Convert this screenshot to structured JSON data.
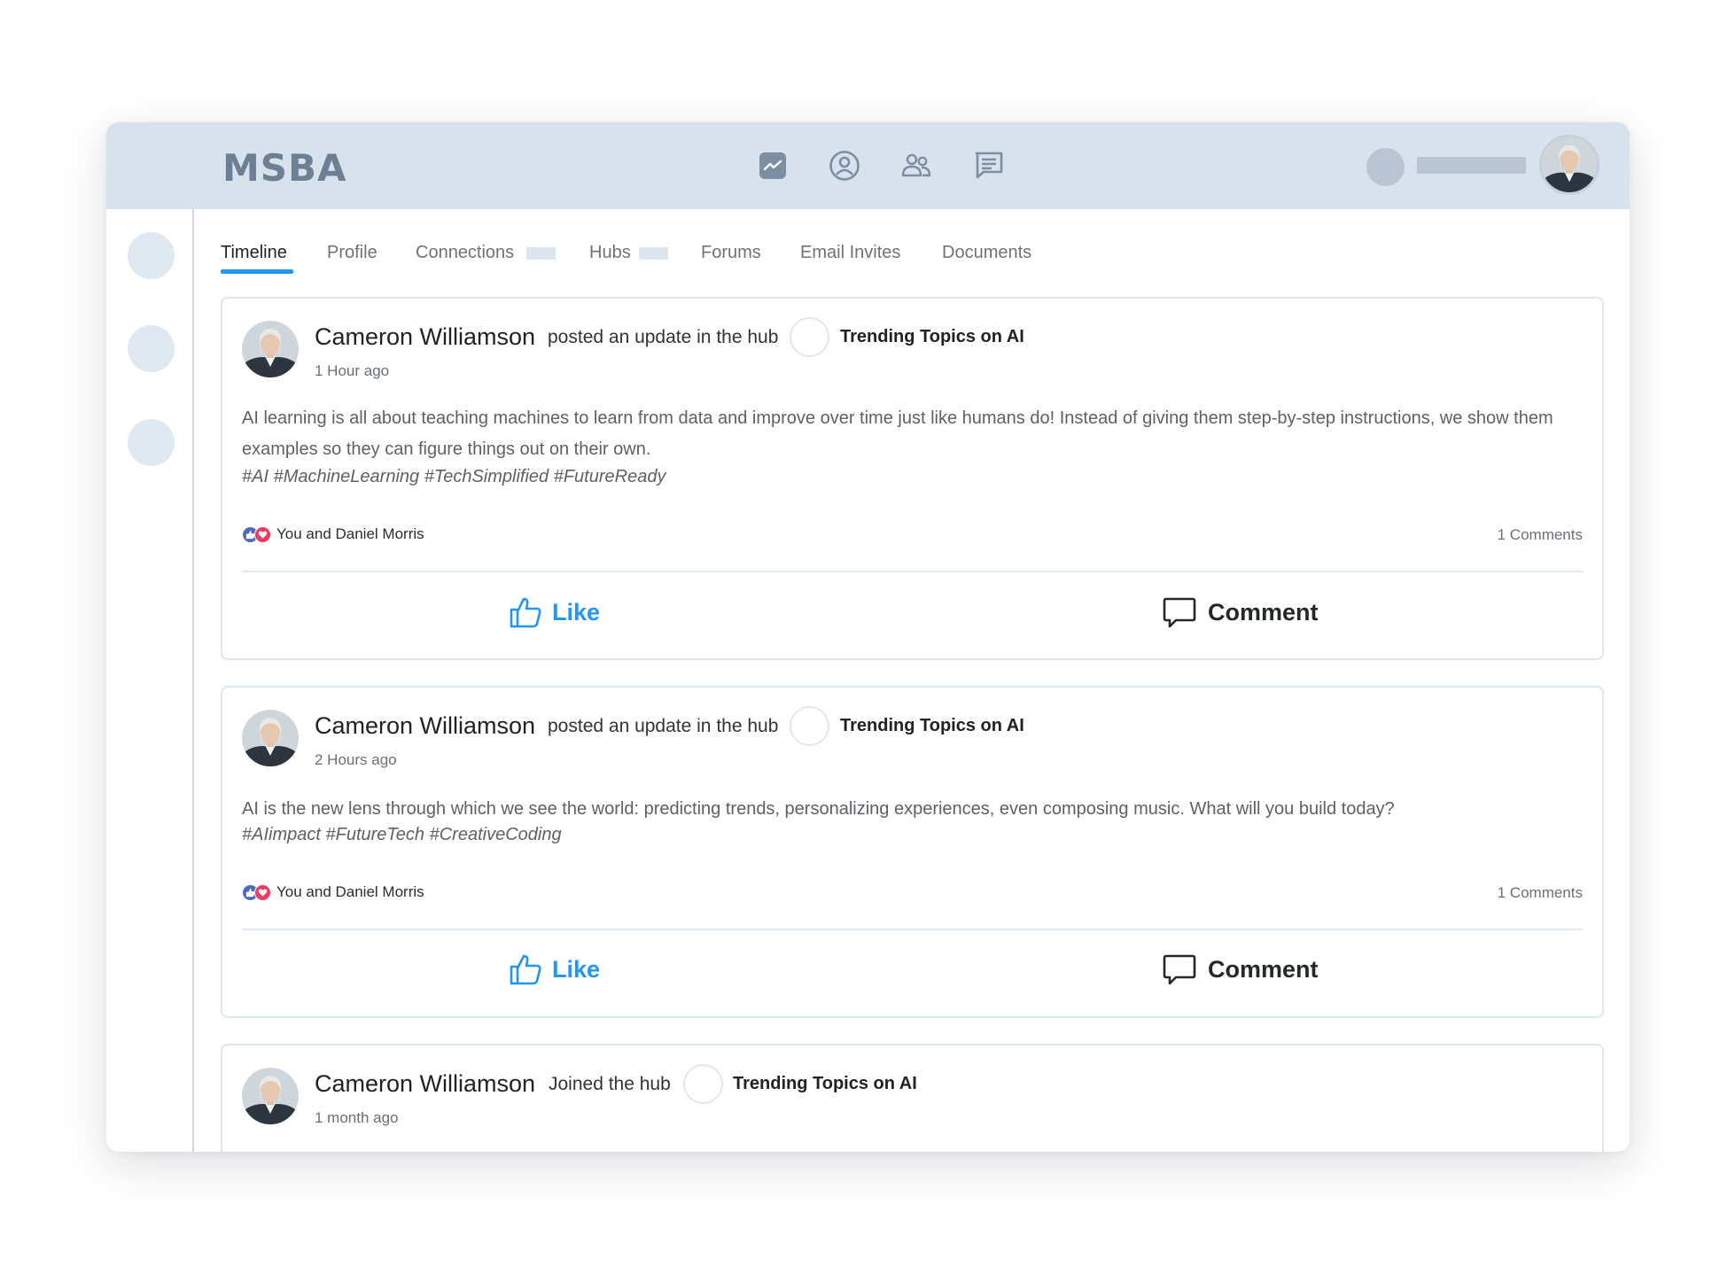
{
  "app": {
    "logo": "MSBA"
  },
  "topnav": {
    "icons": [
      "activity-icon",
      "profile-icon",
      "people-icon",
      "messages-icon"
    ]
  },
  "tabs": [
    "Timeline",
    "Profile",
    "Connections",
    "Hubs",
    "Forums",
    "Email Invites",
    "Documents"
  ],
  "active_tab": "Timeline",
  "colors": {
    "accent": "#2196f3",
    "topbar": "#d7e2ed",
    "like_reaction": "#4a6bc1",
    "heart_reaction": "#ec3c62"
  },
  "posts": [
    {
      "author": "Cameron Williamson",
      "action": "posted an update in the hub",
      "hub": "Trending Topics on AI",
      "time": "1 Hour ago",
      "body": "AI learning is all about teaching machines to learn from data and improve over time just like humans do! Instead of giving them step-by-step instructions, we show them examples so they can figure things out on their own.",
      "tags": "#AI #MachineLearning #TechSimplified #FutureReady",
      "reactions": "You and Daniel Morris",
      "comments": "1 Comments",
      "like_label": "Like",
      "comment_label": "Comment"
    },
    {
      "author": "Cameron Williamson",
      "action": "posted an update in the hub",
      "hub": "Trending Topics on AI",
      "time": "2 Hours ago",
      "body": "AI is the new lens through which we see the world: predicting trends, personalizing experiences, even composing music. What will you build today?",
      "tags": "#AIimpact #FutureTech #CreativeCoding",
      "reactions": "You and Daniel Morris",
      "comments": "1 Comments",
      "like_label": "Like",
      "comment_label": "Comment"
    },
    {
      "author": "Cameron Williamson",
      "action": "Joined the hub",
      "hub": "Trending Topics on AI",
      "time": "1 month ago"
    }
  ]
}
